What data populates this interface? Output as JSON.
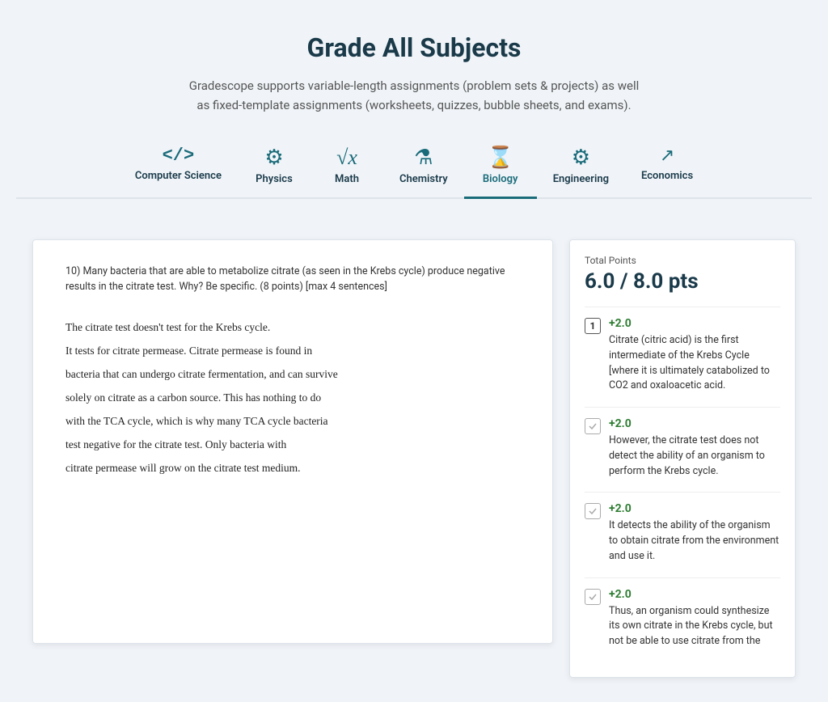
{
  "header": {
    "title": "Grade All Subjects",
    "subtitle": "Gradescope supports variable-length assignments (problem sets & projects) as well as fixed-template assignments (worksheets, quizzes, bubble sheets, and exams)."
  },
  "tabs": [
    {
      "id": "cs",
      "label": "Computer Science",
      "icon": "cs",
      "active": false
    },
    {
      "id": "physics",
      "label": "Physics",
      "icon": "physics",
      "active": false
    },
    {
      "id": "math",
      "label": "Math",
      "icon": "math",
      "active": false
    },
    {
      "id": "chemistry",
      "label": "Chemistry",
      "icon": "chemistry",
      "active": false
    },
    {
      "id": "biology",
      "label": "Biology",
      "icon": "biology",
      "active": true
    },
    {
      "id": "engineering",
      "label": "Engineering",
      "icon": "engineering",
      "active": false
    },
    {
      "id": "economics",
      "label": "Economics",
      "icon": "economics",
      "active": false
    }
  ],
  "question": {
    "number": "10",
    "text": "Many bacteria that are able to metabolize citrate (as seen in the Krebs cycle) produce negative results in the citrate test. Why? Be specific. (8 points) [max 4 sentences]"
  },
  "handwritten_answer": [
    "The citrate test doesn't test for the Krebs cycle.",
    "It tests for citrate permease. Citrate permease is found in",
    "bacteria that can undergo citrate fermentation, and can survive",
    "solely on citrate as a carbon source. This has nothing to do",
    "with the TCA cycle, which is why many TCA cycle bacteria",
    "test negative for the citrate test. Only bacteria with",
    "citrate permease will grow on the citrate test medium."
  ],
  "grading": {
    "total_label": "Total Points",
    "total_value": "6.0 / 8.0 pts",
    "rubric_items": [
      {
        "id": 1,
        "checkbox_type": "number",
        "checkbox_value": "1",
        "points": "+2.0",
        "text": "Citrate (citric acid) is the first intermediate of the Krebs Cycle [where it is ultimately catabolized to CO2 and oxaloacetic acid."
      },
      {
        "id": 2,
        "checkbox_type": "check",
        "checkbox_value": "",
        "points": "+2.0",
        "text": "However, the citrate test does not detect the ability of an organism to perform the Krebs cycle."
      },
      {
        "id": 3,
        "checkbox_type": "check",
        "checkbox_value": "",
        "points": "+2.0",
        "text": "It detects the ability of the organism to obtain citrate from the environment and use it."
      },
      {
        "id": 4,
        "checkbox_type": "check",
        "checkbox_value": "",
        "points": "+2.0",
        "text": "Thus, an organism could synthesize its own citrate in the Krebs cycle, but not be able to use citrate from the"
      }
    ]
  }
}
